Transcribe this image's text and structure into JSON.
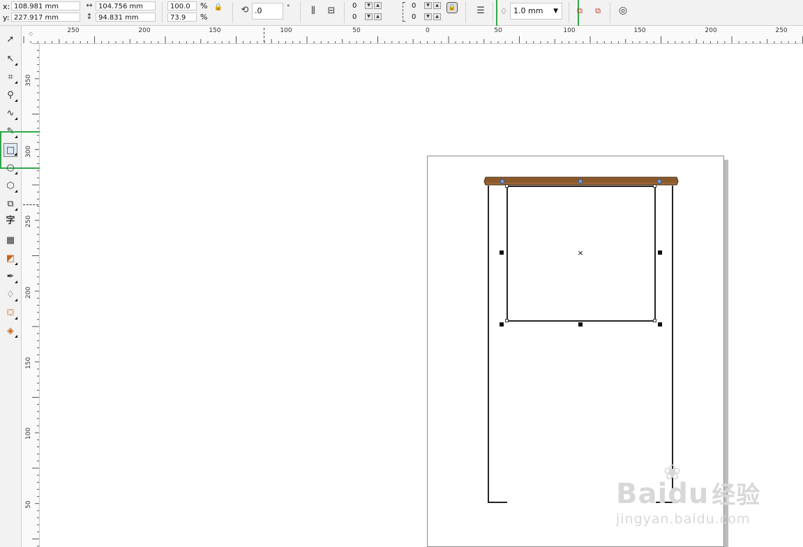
{
  "property_bar": {
    "x_label": "x:",
    "x_value": "108.981 mm",
    "y_label": "y:",
    "y_value": "227.917 mm",
    "width_value": "104.756 mm",
    "height_value": "94.831 mm",
    "scale_x": "100.0",
    "scale_y": "73.9",
    "percent_symbol": "%",
    "rotation_value": ".0",
    "degree_symbol": "°",
    "corner_tl": "0",
    "corner_bl": "0",
    "corner_tr": "0",
    "corner_br": "0",
    "outline_width": "1.0 mm"
  },
  "ruler_top": {
    "labels": [
      "250",
      "200",
      "150",
      "100",
      "50",
      "0",
      "50",
      "100",
      "150",
      "200",
      "250"
    ]
  },
  "ruler_left": {
    "labels": [
      "350",
      "300",
      "250",
      "200",
      "150",
      "100",
      "50"
    ]
  },
  "toolbox": {
    "tools": [
      {
        "name": "pick-tool",
        "icon": "arrow-icon"
      },
      {
        "name": "shape-tool",
        "icon": "shape-icon"
      },
      {
        "name": "crop-tool",
        "icon": "crop-icon"
      },
      {
        "name": "zoom-tool",
        "icon": "zoom-icon"
      },
      {
        "name": "freehand-tool",
        "icon": "freehand-icon"
      },
      {
        "name": "smart-fill-tool",
        "icon": "smart-fill-icon"
      },
      {
        "name": "rectangle-tool",
        "icon": "rectangle-icon"
      },
      {
        "name": "ellipse-tool",
        "icon": "ellipse-icon"
      },
      {
        "name": "polygon-tool",
        "icon": "polygon-icon"
      },
      {
        "name": "basic-shapes-tool",
        "icon": "basic-shapes-icon"
      },
      {
        "name": "text-tool",
        "icon": "text-icon",
        "glyph": "字"
      },
      {
        "name": "table-tool",
        "icon": "table-icon"
      },
      {
        "name": "interactive-tool",
        "icon": "interactive-icon"
      },
      {
        "name": "eyedropper-tool",
        "icon": "eyedropper-icon"
      },
      {
        "name": "outline-tool",
        "icon": "outline-pen-icon"
      },
      {
        "name": "fill-tool",
        "icon": "fill-bucket-icon"
      },
      {
        "name": "interactive-fill-tool",
        "icon": "interactive-fill-icon"
      }
    ]
  },
  "canvas": {
    "shelf_top_color": "#8b5a2b",
    "outline_color": "#222222",
    "page_border_color": "#8c8c8c",
    "highlight_color": "#2ea84a"
  },
  "watermark": {
    "brand_latin": "Baidu",
    "brand_cn": "经验",
    "url": "jingyan.baidu.com"
  }
}
